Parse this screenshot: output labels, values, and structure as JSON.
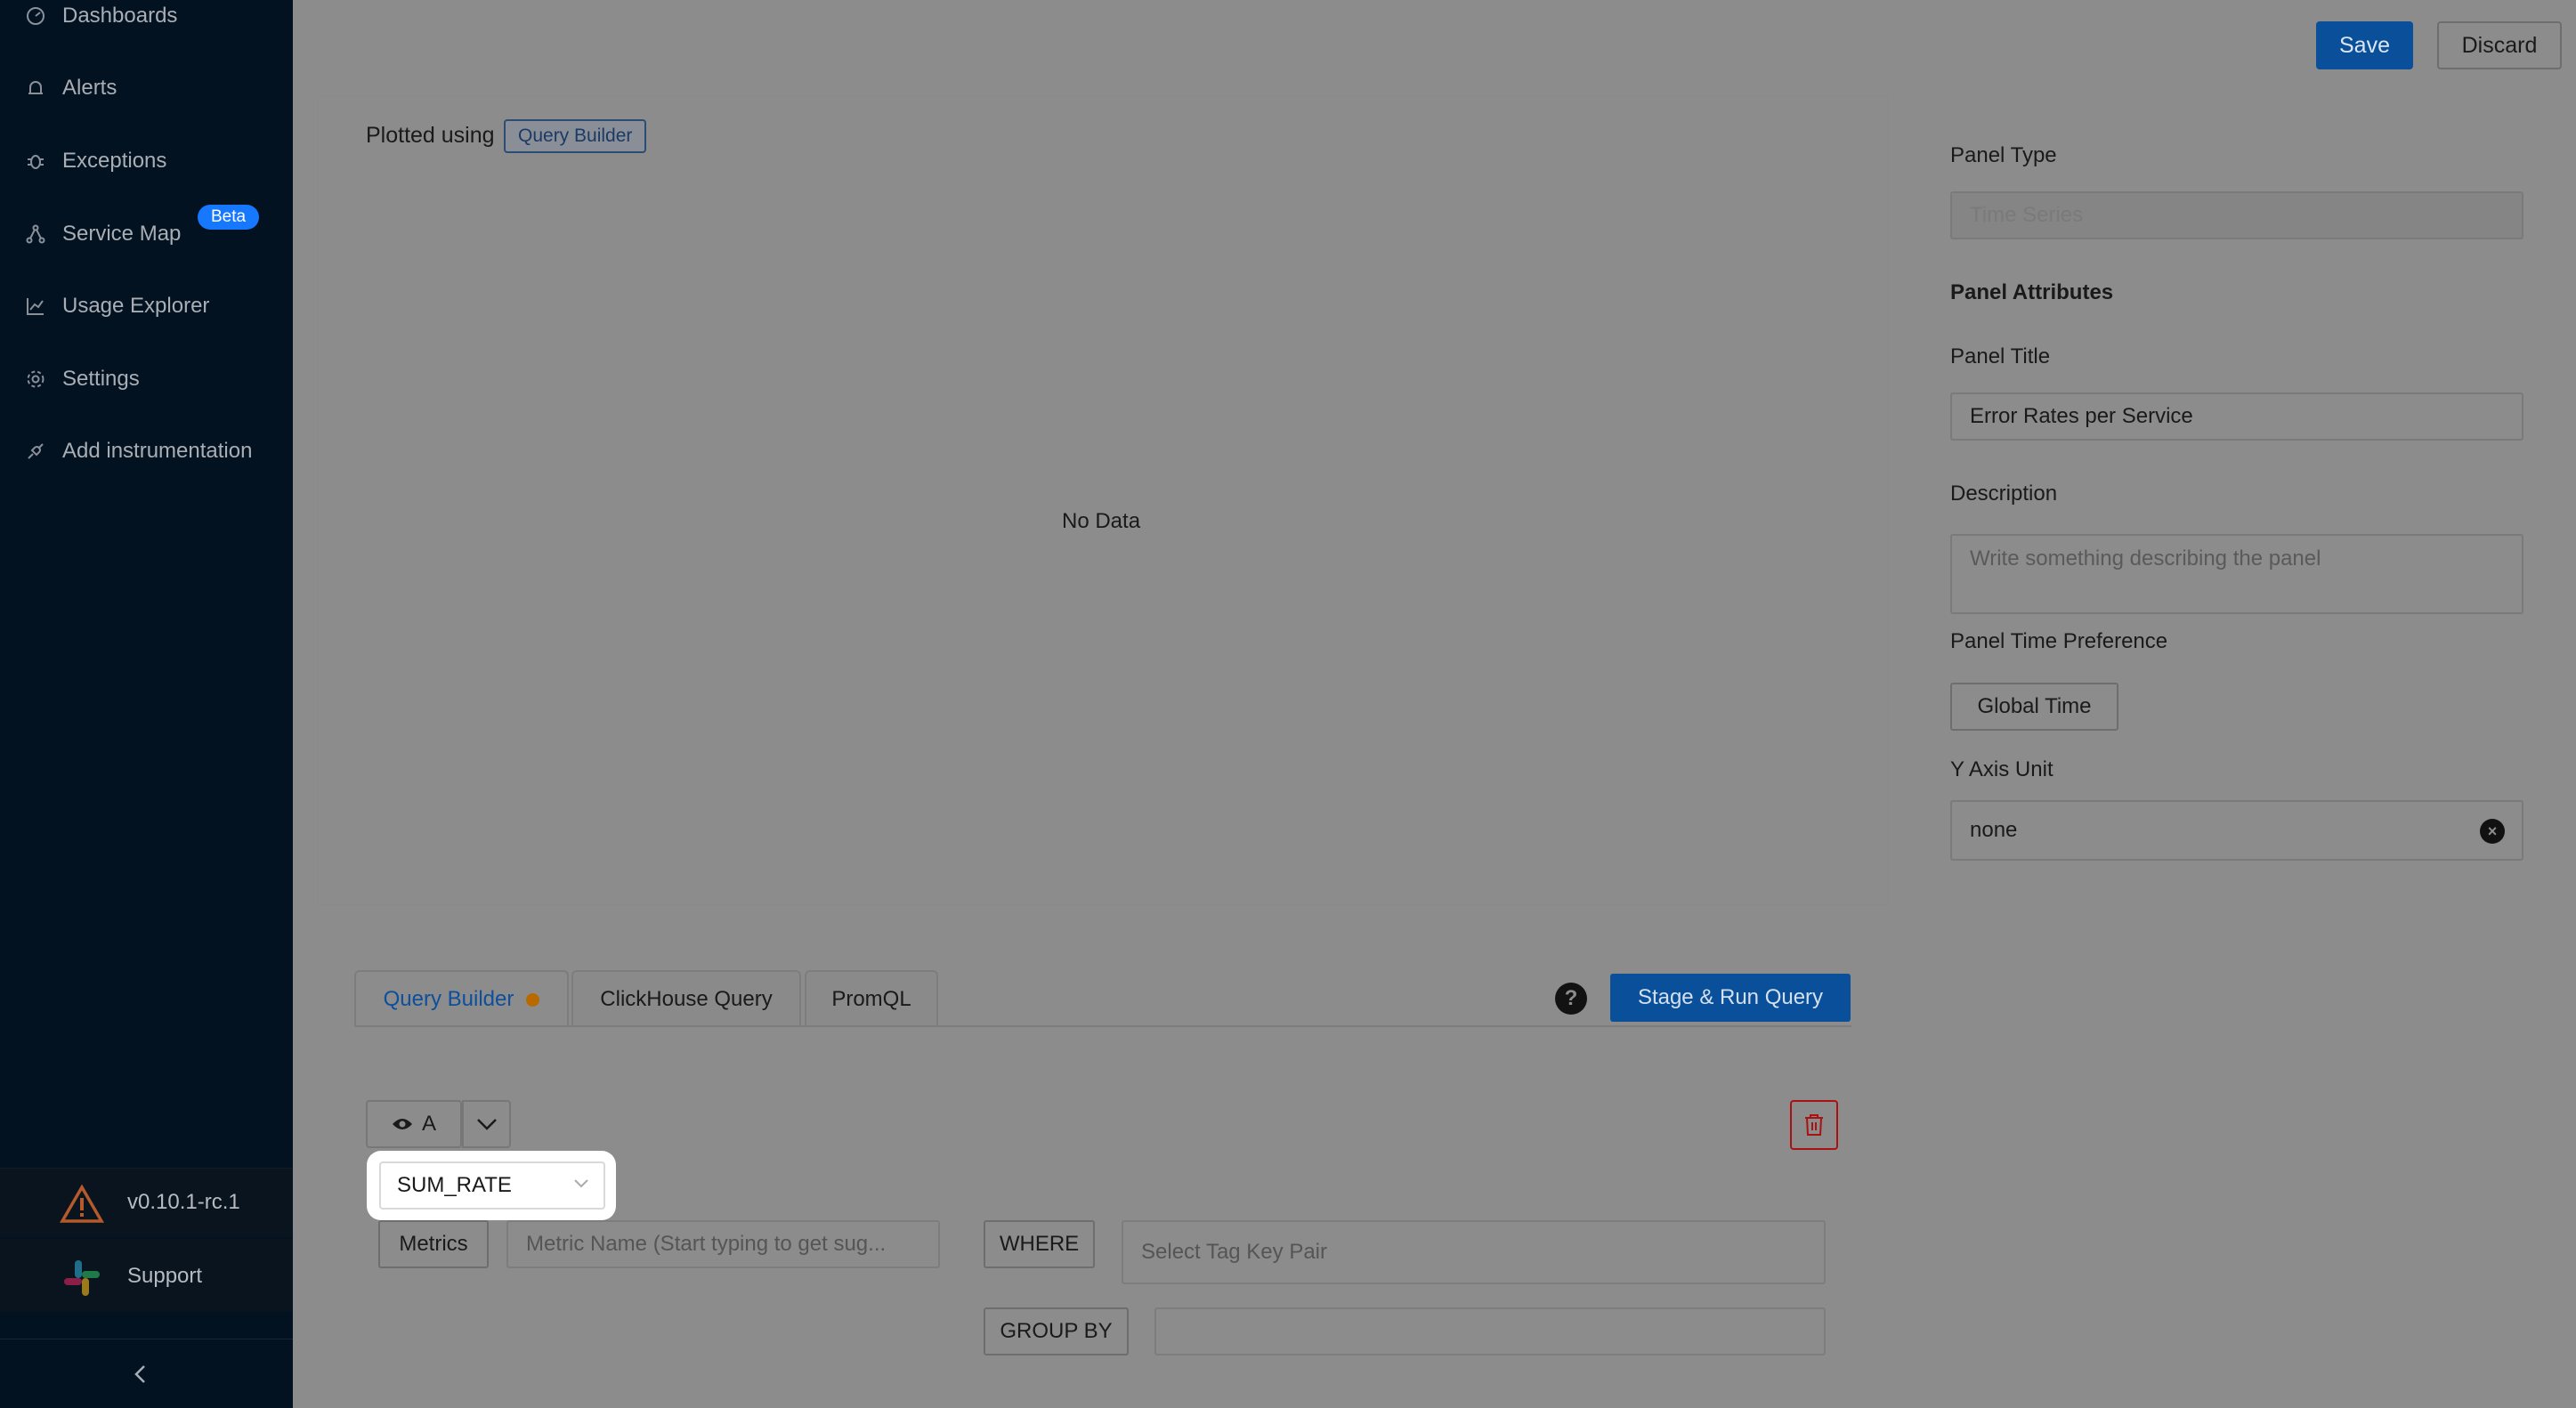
{
  "sidebar": {
    "items": [
      {
        "label": "Dashboards",
        "icon": "dashboard-icon"
      },
      {
        "label": "Alerts",
        "icon": "alert-icon"
      },
      {
        "label": "Exceptions",
        "icon": "bug-icon"
      },
      {
        "label": "Service Map",
        "icon": "service-map-icon",
        "badge": "Beta"
      },
      {
        "label": "Usage Explorer",
        "icon": "line-chart-icon"
      },
      {
        "label": "Settings",
        "icon": "gear-icon"
      },
      {
        "label": "Add instrumentation",
        "icon": "api-icon"
      }
    ],
    "version": "v0.10.1-rc.1",
    "support": "Support"
  },
  "header": {
    "save_label": "Save",
    "discard_label": "Discard"
  },
  "chart": {
    "plotted_using": "Plotted using",
    "builder_tag": "Query Builder",
    "empty_text": "No Data"
  },
  "query": {
    "tabs": [
      "Query Builder",
      "ClickHouse Query",
      "PromQL"
    ],
    "help": "?",
    "run_label": "Stage & Run Query",
    "query_name": "A",
    "aggregate": "SUM_RATE",
    "metrics_label": "Metrics",
    "metrics_placeholder": "Metric Name (Start typing to get sug...",
    "where_label": "WHERE",
    "where_placeholder": "Select Tag Key Pair",
    "groupby_label": "GROUP BY"
  },
  "settings": {
    "panel_type_label": "Panel Type",
    "panel_type_value": "Time Series",
    "attributes_heading": "Panel Attributes",
    "title_label": "Panel Title",
    "title_value": "Error Rates per Service",
    "description_label": "Description",
    "description_placeholder": "Write something describing the  panel",
    "time_pref_label": "Panel Time Preference",
    "time_pref_value": "Global Time",
    "y_axis_label": "Y Axis Unit",
    "y_axis_value": "none"
  },
  "colors": {
    "sidebar_bg": "#031220",
    "overlay_bg": "#8c8c8c",
    "primary": "#0a4f9a",
    "danger": "#aa1111",
    "pending_dot": "#b86a00"
  }
}
